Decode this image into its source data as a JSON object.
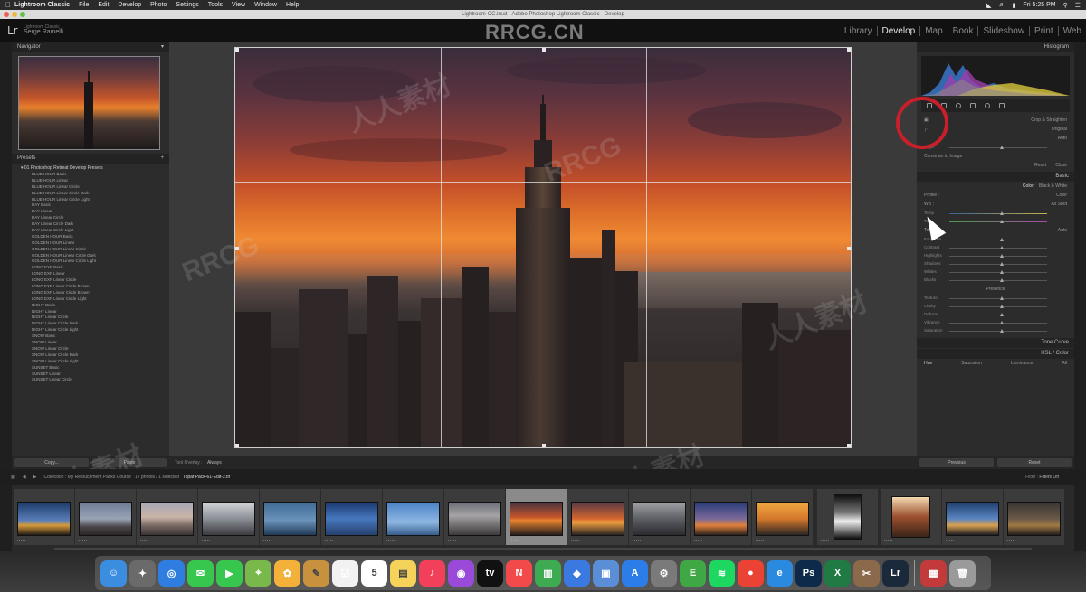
{
  "menubar": {
    "app_name": "Lightroom Classic",
    "items": [
      "File",
      "Edit",
      "Develop",
      "Photo",
      "Settings",
      "Tools",
      "View",
      "Window",
      "Help"
    ],
    "clock": "Fri 5:25 PM"
  },
  "window": {
    "title": "Lightroom-CC.lrcat - Adobe Photoshop Lightroom Classic - Develop"
  },
  "identity_plate": {
    "app": "Lightroom Classic",
    "name": "Serge Ramelli",
    "logo": "Lr"
  },
  "watermark": "RRCG.CN",
  "modules": [
    "Library",
    "Develop",
    "Map",
    "Book",
    "Slideshow",
    "Print",
    "Web"
  ],
  "active_module": "Develop",
  "left_panel": {
    "navigator_title": "Navigator",
    "presets_title": "Presets",
    "preset_folder": "01 Photoshop Retreat Develop Presets",
    "preset_items": [
      "BLUE HOUR Basic",
      "BLUE HOUR Linear",
      "BLUE HOUR Linear Circle",
      "BLUE HOUR Linear Circle Dark",
      "BLUE HOUR Linear Circle Light",
      "DAY Basic",
      "DAY Linear",
      "DAY Linear Circle",
      "DAY Linear Circle Dark",
      "DAY Linear Circle Light",
      "GOLDEN HOUR Basic",
      "GOLDEN HOUR Linear",
      "GOLDEN HOUR Linear Circle",
      "GOLDEN HOUR Linear Circle Dark",
      "GOLDEN HOUR Linear Circle Light",
      "LONG EXP Basic",
      "LONG EXP Linear",
      "LONG EXP Linear Circle",
      "LONG EXP Linear Circle Brown",
      "LONG EXP Linear Circle Brown",
      "LONG EXP Linear Circle Light",
      "NIGHT Basic",
      "NIGHT Linear",
      "NIGHT Linear Circle",
      "NIGHT Linear Circle Dark",
      "NIGHT Linear Circle Light",
      "SNOW Basic",
      "SNOW Linear",
      "SNOW Linear Circle",
      "SNOW Linear Circle Dark",
      "SNOW Linear Circle Light",
      "SUNSET Basic",
      "SUNSET Linear",
      "SUNSET Linear Circle"
    ],
    "copy_button": "Copy...",
    "paste_button": "Paste"
  },
  "center": {
    "tool_overlay_label": "Tool Overlay :",
    "tool_overlay_value": "Always"
  },
  "right_panel": {
    "histogram_title": "Histogram",
    "crop_section": "Crop & Straighten",
    "original_label": "Original",
    "angle_label": "Angle",
    "auto_label": "Auto",
    "constrain_label": "Constrain to Image",
    "reset_label": "Reset",
    "close_label": "Close",
    "basic_title": "Basic",
    "treatment_color": "Color",
    "treatment_bw": "Black & White",
    "profile_label": "Profile :",
    "profile_value": "Color",
    "wb_label": "WB :",
    "wb_value": "As Shot",
    "temp_label": "Temp",
    "tint_label": "Tint",
    "tone_label": "Tone",
    "tone_auto": "Auto",
    "sliders_tone": [
      "Exposure",
      "Contrast",
      "Highlights",
      "Shadows",
      "Whites",
      "Blacks"
    ],
    "presence_label": "Presence",
    "sliders_presence": [
      "Texture",
      "Clarity",
      "Dehaze",
      "Vibrance",
      "Saturation"
    ],
    "tone_curve_title": "Tone Curve",
    "hsl_title": "HSL / Color",
    "hsl_tabs": [
      "Hue",
      "Saturation",
      "Luminance",
      "All"
    ],
    "previous_button": "Previous",
    "reset_button": "Reset"
  },
  "filmstrip": {
    "path_label": "Collection : My Retouchment Packs Course",
    "count_label": "17 photos / 1 selected",
    "selected_file": "Topaf Pack-61-Edit-2.tif",
    "filter_label": "Filter :",
    "filter_value": "Filters Off"
  },
  "dock_apps": [
    "Finder",
    "Launchpad",
    "Safari",
    "Messages",
    "Facetime",
    "Maps",
    "Photos",
    "Notes",
    "Reminders",
    "Calendar",
    "Stickies",
    "Music",
    "Podcasts",
    "TV",
    "News",
    "Numbers",
    "Keynote",
    "Preview",
    "App Store",
    "System Preferences",
    "Evernote",
    "Spotify",
    "Chrome",
    "Edge",
    "Photoshop",
    "Excel",
    "Gimp",
    "Lightroom",
    "Photo Booth",
    "Trash"
  ],
  "dock_badges": {
    "calendar_day": "5"
  }
}
